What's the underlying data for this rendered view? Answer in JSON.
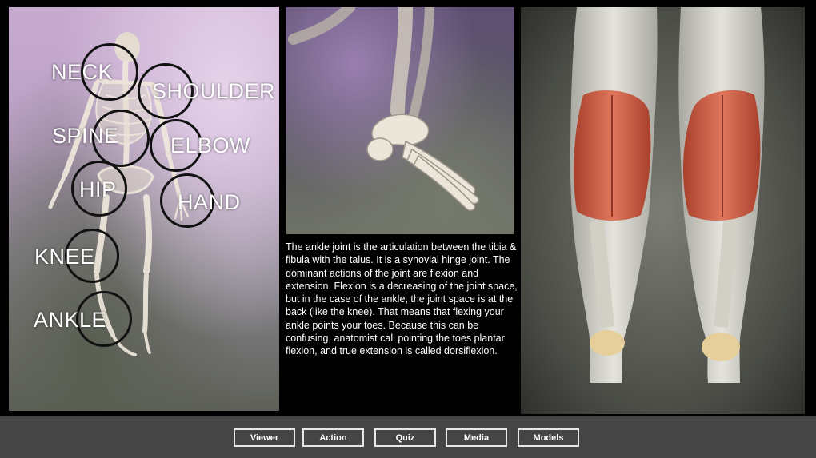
{
  "skeleton": {
    "joints": {
      "neck": "NECK",
      "shoulder": "SHOULDER",
      "spine": "SPINE",
      "elbow": "ELBOW",
      "hip": "HIP",
      "hand": "HAND",
      "knee": "KNEE",
      "ankle": "ANKLE"
    }
  },
  "description": "The ankle joint is the articulation between the tibia & fibula with the talus. It is a synovial hinge joint. The dominant actions of the joint are flexion and extension. Flexion is a decreasing of the joint space, but in the case of the ankle, the joint space is at the back  (like the knee). That means that flexing your ankle points your toes. Because this can be confusing, anatomist call pointing the toes plantar flexion, and true extension is called dorsiflexion.",
  "nav": {
    "viewer": "Viewer",
    "action": "Action",
    "quiz": "Quiz",
    "media": "Media",
    "models": "Models"
  },
  "colors": {
    "muscle": "#c8563f",
    "bone": "#e9e2d0",
    "bar": "#454545"
  }
}
